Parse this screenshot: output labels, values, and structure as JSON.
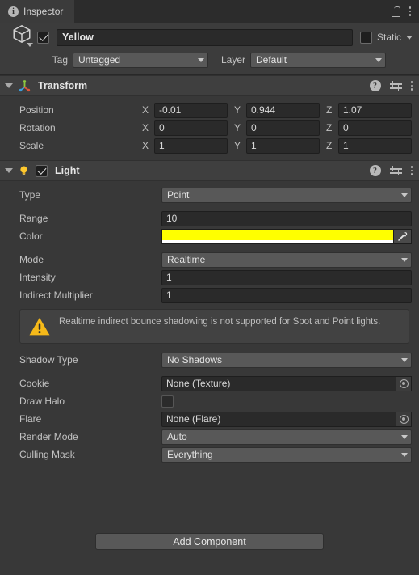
{
  "window": {
    "tab_label": "Inspector",
    "tab_icon": "info-icon",
    "lock_icon": "unlocked-padlock-icon",
    "menu_icon": "kebab-menu-icon"
  },
  "gameobject": {
    "icon": "cube-icon",
    "enabled": true,
    "name": "Yellow",
    "static_label": "Static",
    "static_checked": false,
    "tag_label": "Tag",
    "tag_value": "Untagged",
    "layer_label": "Layer",
    "layer_value": "Default"
  },
  "components": [
    {
      "name": "Transform",
      "icon": "transform-axis-icon",
      "expanded": true,
      "has_checkbox": false,
      "vector_rows": [
        {
          "label": "Position",
          "x": "-0.01",
          "y": "0.944",
          "z": "1.07"
        },
        {
          "label": "Rotation",
          "x": "0",
          "y": "0",
          "z": "0"
        },
        {
          "label": "Scale",
          "x": "1",
          "y": "1",
          "z": "1"
        }
      ],
      "axis_labels": {
        "x": "X",
        "y": "Y",
        "z": "Z"
      }
    },
    {
      "name": "Light",
      "icon": "lightbulb-icon",
      "expanded": true,
      "has_checkbox": true,
      "enabled": true,
      "fields": {
        "type_label": "Type",
        "type_value": "Point",
        "range_label": "Range",
        "range_value": "10",
        "color_label": "Color",
        "color_value": "#FFFF00",
        "color_alpha": "#FFFFFF",
        "mode_label": "Mode",
        "mode_value": "Realtime",
        "intensity_label": "Intensity",
        "intensity_value": "1",
        "indirect_label": "Indirect Multiplier",
        "indirect_value": "1",
        "warning_text": "Realtime indirect bounce shadowing is not supported for Spot and Point lights.",
        "warning_icon": "warning-triangle-icon",
        "shadow_label": "Shadow Type",
        "shadow_value": "No Shadows",
        "cookie_label": "Cookie",
        "cookie_value": "None (Texture)",
        "halo_label": "Draw Halo",
        "halo_checked": false,
        "flare_label": "Flare",
        "flare_value": "None (Flare)",
        "render_label": "Render Mode",
        "render_value": "Auto",
        "culling_label": "Culling Mask",
        "culling_value": "Everything"
      }
    }
  ],
  "header_icons": {
    "help": "?",
    "preset": "preset-settings-icon",
    "menu": "kebab-menu-icon"
  },
  "footer": {
    "add_component_label": "Add Component"
  },
  "colors": {
    "panel_bg": "#383838",
    "tabbar_bg": "#2c2c2c",
    "field_bg": "#2a2a2a",
    "dropdown_bg": "#585858",
    "warning_yellow": "#FFC107",
    "light_color": "#FFFF00"
  }
}
